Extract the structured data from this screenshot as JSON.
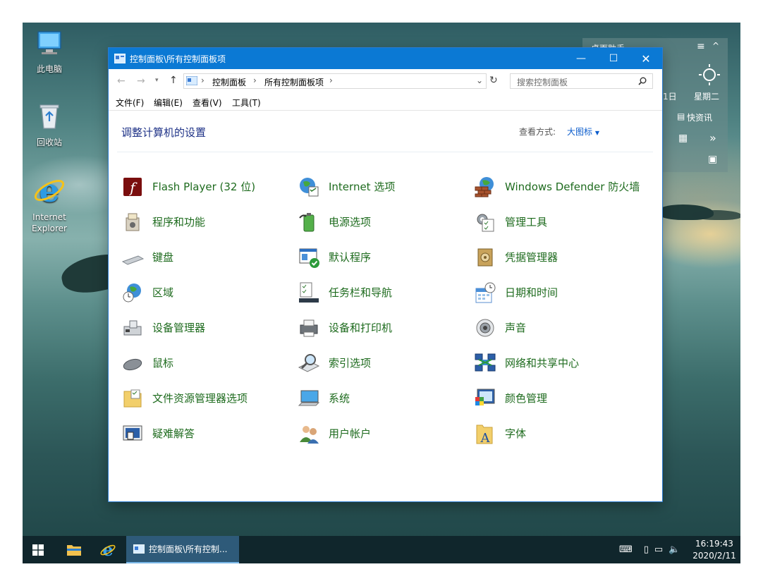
{
  "desktop": {
    "icons": [
      {
        "label": "此电脑",
        "icon": "computer-icon"
      },
      {
        "label": "回收站",
        "icon": "recycle-bin-icon"
      },
      {
        "label": "Internet\nExplorer",
        "icon": "internet-explorer-icon"
      }
    ],
    "widget": {
      "title": "桌面助手",
      "day": "1日",
      "weekday": "星期二",
      "quick_note": "快资讯"
    }
  },
  "window": {
    "title": "控制面板\\所有控制面板项",
    "breadcrumb": [
      "控制面板",
      "所有控制面板项"
    ],
    "search_placeholder": "搜索控制面板",
    "menu": [
      "文件(F)",
      "编辑(E)",
      "查看(V)",
      "工具(T)"
    ],
    "heading": "调整计算机的设置",
    "view_by_label": "查看方式:",
    "view_by_value": "大图标",
    "items": [
      {
        "label": "Flash Player (32 位)",
        "icon": "flash-player-icon"
      },
      {
        "label": "Internet 选项",
        "icon": "internet-options-icon"
      },
      {
        "label": "Windows Defender 防火墙",
        "icon": "firewall-icon"
      },
      {
        "label": "程序和功能",
        "icon": "programs-features-icon"
      },
      {
        "label": "电源选项",
        "icon": "power-options-icon"
      },
      {
        "label": "管理工具",
        "icon": "admin-tools-icon"
      },
      {
        "label": "键盘",
        "icon": "keyboard-icon"
      },
      {
        "label": "默认程序",
        "icon": "default-programs-icon"
      },
      {
        "label": "凭据管理器",
        "icon": "credential-manager-icon"
      },
      {
        "label": "区域",
        "icon": "region-icon"
      },
      {
        "label": "任务栏和导航",
        "icon": "taskbar-navigation-icon"
      },
      {
        "label": "日期和时间",
        "icon": "date-time-icon"
      },
      {
        "label": "设备管理器",
        "icon": "device-manager-icon"
      },
      {
        "label": "设备和打印机",
        "icon": "devices-printers-icon"
      },
      {
        "label": "声音",
        "icon": "sound-icon"
      },
      {
        "label": "鼠标",
        "icon": "mouse-icon"
      },
      {
        "label": "索引选项",
        "icon": "indexing-options-icon"
      },
      {
        "label": "网络和共享中心",
        "icon": "network-sharing-icon"
      },
      {
        "label": "文件资源管理器选项",
        "icon": "explorer-options-icon"
      },
      {
        "label": "系统",
        "icon": "system-icon"
      },
      {
        "label": "颜色管理",
        "icon": "color-management-icon"
      },
      {
        "label": "疑难解答",
        "icon": "troubleshooting-icon"
      },
      {
        "label": "用户帐户",
        "icon": "user-accounts-icon"
      },
      {
        "label": "字体",
        "icon": "fonts-icon"
      }
    ]
  },
  "taskbar": {
    "active_task": "控制面板\\所有控制...",
    "time": "16:19:43",
    "date": "2020/2/11"
  },
  "colors": {
    "titlebar": "#0b79d4",
    "link_green": "#1e6b1e",
    "heading_blue": "#1e3287",
    "taskbar": "#10262c"
  }
}
